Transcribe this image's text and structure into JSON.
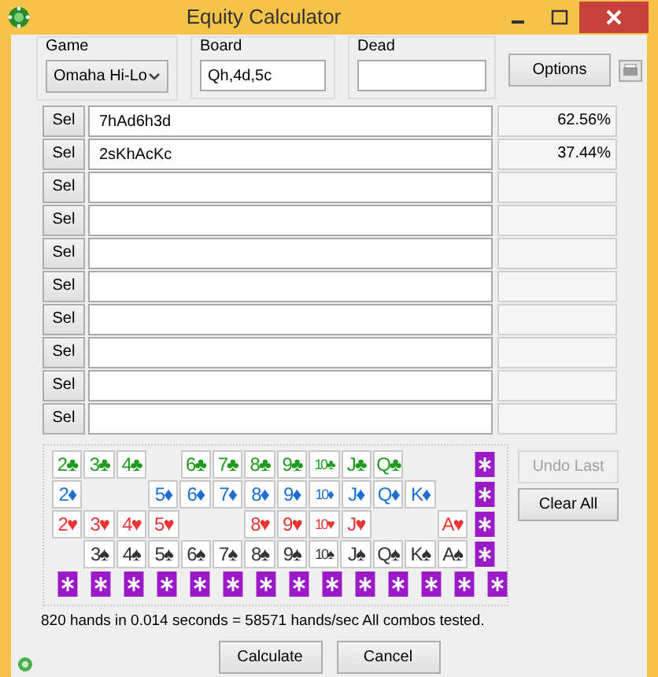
{
  "window": {
    "title": "Equity Calculator"
  },
  "game": {
    "label": "Game",
    "value": "Omaha Hi-Lo"
  },
  "board": {
    "label": "Board",
    "value": "Qh,4d,5c"
  },
  "dead": {
    "label": "Dead"
  },
  "options_button": "Options",
  "hands": [
    {
      "button": "Sel",
      "value": "7hAd6h3d",
      "equity": "62.56%"
    },
    {
      "button": "Sel",
      "value": "2sKhAcKc",
      "equity": "37.44%"
    },
    {
      "button": "Sel"
    },
    {
      "button": "Sel"
    },
    {
      "button": "Sel"
    },
    {
      "button": "Sel"
    },
    {
      "button": "Sel"
    },
    {
      "button": "Sel"
    },
    {
      "button": "Sel"
    },
    {
      "button": "Sel"
    }
  ],
  "card_rows": [
    {
      "color": "#1f9a1f",
      "cards": [
        {
          "kind": "card",
          "rank": "2",
          "suit": "♣"
        },
        {
          "kind": "card",
          "rank": "3",
          "suit": "♣"
        },
        {
          "kind": "card",
          "rank": "4",
          "suit": "♣"
        },
        {
          "kind": "gap"
        },
        {
          "kind": "card",
          "rank": "6",
          "suit": "♣"
        },
        {
          "kind": "card",
          "rank": "7",
          "suit": "♣"
        },
        {
          "kind": "card",
          "rank": "8",
          "suit": "♣"
        },
        {
          "kind": "card",
          "rank": "9",
          "suit": "♣"
        },
        {
          "kind": "card",
          "rank": "10",
          "suit": "♣"
        },
        {
          "kind": "card",
          "rank": "J",
          "suit": "♣"
        },
        {
          "kind": "card",
          "rank": "Q",
          "suit": "♣"
        },
        {
          "kind": "gap"
        },
        {
          "kind": "gap"
        },
        {
          "kind": "joker"
        }
      ]
    },
    {
      "color": "#1e6fd0",
      "cards": [
        {
          "kind": "card",
          "rank": "2",
          "suit": "♦"
        },
        {
          "kind": "gap"
        },
        {
          "kind": "gap"
        },
        {
          "kind": "card",
          "rank": "5",
          "suit": "♦"
        },
        {
          "kind": "card",
          "rank": "6",
          "suit": "♦"
        },
        {
          "kind": "card",
          "rank": "7",
          "suit": "♦"
        },
        {
          "kind": "card",
          "rank": "8",
          "suit": "♦"
        },
        {
          "kind": "card",
          "rank": "9",
          "suit": "♦"
        },
        {
          "kind": "card",
          "rank": "10",
          "suit": "♦"
        },
        {
          "kind": "card",
          "rank": "J",
          "suit": "♦"
        },
        {
          "kind": "card",
          "rank": "Q",
          "suit": "♦"
        },
        {
          "kind": "card",
          "rank": "K",
          "suit": "♦"
        },
        {
          "kind": "gap"
        },
        {
          "kind": "joker"
        }
      ]
    },
    {
      "color": "#e83535",
      "cards": [
        {
          "kind": "card",
          "rank": "2",
          "suit": "♥"
        },
        {
          "kind": "card",
          "rank": "3",
          "suit": "♥"
        },
        {
          "kind": "card",
          "rank": "4",
          "suit": "♥"
        },
        {
          "kind": "card",
          "rank": "5",
          "suit": "♥"
        },
        {
          "kind": "gap"
        },
        {
          "kind": "gap"
        },
        {
          "kind": "card",
          "rank": "8",
          "suit": "♥"
        },
        {
          "kind": "card",
          "rank": "9",
          "suit": "♥"
        },
        {
          "kind": "card",
          "rank": "10",
          "suit": "♥"
        },
        {
          "kind": "card",
          "rank": "J",
          "suit": "♥"
        },
        {
          "kind": "gap"
        },
        {
          "kind": "gap"
        },
        {
          "kind": "card",
          "rank": "A",
          "suit": "♥"
        },
        {
          "kind": "joker"
        }
      ]
    },
    {
      "color": "#333333",
      "cards": [
        {
          "kind": "gap"
        },
        {
          "kind": "card",
          "rank": "3",
          "suit": "♠"
        },
        {
          "kind": "card",
          "rank": "4",
          "suit": "♠"
        },
        {
          "kind": "card",
          "rank": "5",
          "suit": "♠"
        },
        {
          "kind": "card",
          "rank": "6",
          "suit": "♠"
        },
        {
          "kind": "card",
          "rank": "7",
          "suit": "♠"
        },
        {
          "kind": "card",
          "rank": "8",
          "suit": "♠"
        },
        {
          "kind": "card",
          "rank": "9",
          "suit": "♠"
        },
        {
          "kind": "card",
          "rank": "10",
          "suit": "♠"
        },
        {
          "kind": "card",
          "rank": "J",
          "suit": "♠"
        },
        {
          "kind": "card",
          "rank": "Q",
          "suit": "♠"
        },
        {
          "kind": "card",
          "rank": "K",
          "suit": "♠"
        },
        {
          "kind": "card",
          "rank": "A",
          "suit": "♠"
        },
        {
          "kind": "joker"
        }
      ]
    },
    {
      "cards": [
        {
          "kind": "joker"
        },
        {
          "kind": "joker"
        },
        {
          "kind": "joker"
        },
        {
          "kind": "joker"
        },
        {
          "kind": "joker"
        },
        {
          "kind": "joker"
        },
        {
          "kind": "joker"
        },
        {
          "kind": "joker"
        },
        {
          "kind": "joker"
        },
        {
          "kind": "joker"
        },
        {
          "kind": "joker"
        },
        {
          "kind": "joker"
        },
        {
          "kind": "joker"
        },
        {
          "kind": "joker"
        }
      ]
    }
  ],
  "side_buttons": [
    {
      "label": "Undo Last",
      "disabled": true
    },
    {
      "label": "Clear All",
      "disabled": false
    }
  ],
  "status": "820 hands in 0.014 seconds = 58571 hands/sec All combos tested.",
  "buttons": [
    "Calculate",
    "Cancel"
  ]
}
